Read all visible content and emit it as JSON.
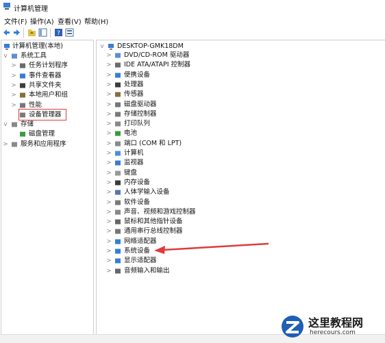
{
  "window": {
    "title": "计算机管理"
  },
  "menu": [
    "文件(F)",
    "操作(A)",
    "查看(V)",
    "帮助(H)"
  ],
  "left_tree": {
    "root": "计算机管理(本地)",
    "items": [
      {
        "label": "系统工具",
        "level": 1,
        "arrow": "v",
        "icon": "tools-icon"
      },
      {
        "label": "任务计划程序",
        "level": 2,
        "arrow": ">",
        "icon": "clock-icon"
      },
      {
        "label": "事件查看器",
        "level": 2,
        "arrow": ">",
        "icon": "event-viewer-icon"
      },
      {
        "label": "共享文件夹",
        "level": 2,
        "arrow": ">",
        "icon": "shared-folder-icon"
      },
      {
        "label": "本地用户和组",
        "level": 2,
        "arrow": ">",
        "icon": "users-icon"
      },
      {
        "label": "性能",
        "level": 2,
        "arrow": ">",
        "icon": "performance-icon"
      },
      {
        "label": "设备管理器",
        "level": 2,
        "arrow": "",
        "icon": "device-manager-icon",
        "selected": true
      },
      {
        "label": "存储",
        "level": 1,
        "arrow": "v",
        "icon": "storage-icon"
      },
      {
        "label": "磁盘管理",
        "level": 2,
        "arrow": "",
        "icon": "disk-icon"
      },
      {
        "label": "服务和应用程序",
        "level": 1,
        "arrow": ">",
        "icon": "services-icon"
      }
    ]
  },
  "device_tree": {
    "root": "DESKTOP-GMK18DM",
    "items": [
      {
        "label": "DVD/CD-ROM 驱动器",
        "icon": "dvd-icon"
      },
      {
        "label": "IDE ATA/ATAPI 控制器",
        "icon": "ide-icon"
      },
      {
        "label": "便携设备",
        "icon": "portable-icon"
      },
      {
        "label": "处理器",
        "icon": "cpu-icon"
      },
      {
        "label": "传感器",
        "icon": "sensor-icon"
      },
      {
        "label": "磁盘驱动器",
        "icon": "disk-drive-icon"
      },
      {
        "label": "存储控制器",
        "icon": "storage-controller-icon"
      },
      {
        "label": "打印队列",
        "icon": "printer-icon"
      },
      {
        "label": "电池",
        "icon": "battery-icon"
      },
      {
        "label": "端口 (COM 和 LPT)",
        "icon": "port-icon"
      },
      {
        "label": "计算机",
        "icon": "computer-icon"
      },
      {
        "label": "监视器",
        "icon": "monitor-icon"
      },
      {
        "label": "键盘",
        "icon": "keyboard-icon"
      },
      {
        "label": "内存设备",
        "icon": "memory-icon"
      },
      {
        "label": "人体学输入设备",
        "icon": "hid-icon"
      },
      {
        "label": "软件设备",
        "icon": "software-device-icon"
      },
      {
        "label": "声音、视频和游戏控制器",
        "icon": "sound-icon"
      },
      {
        "label": "鼠标和其他指针设备",
        "icon": "mouse-icon"
      },
      {
        "label": "通用串行总线控制器",
        "icon": "usb-icon"
      },
      {
        "label": "网络适配器",
        "icon": "network-icon"
      },
      {
        "label": "系统设备",
        "icon": "system-device-icon"
      },
      {
        "label": "显示适配器",
        "icon": "display-adapter-icon"
      },
      {
        "label": "音频输入和输出",
        "icon": "audio-io-icon"
      }
    ]
  },
  "annotation": {
    "arrow_color": "#e03a3a",
    "target": "系统设备"
  },
  "watermark": {
    "title": "这里教程网",
    "url": "herecours.com"
  },
  "colors": {
    "accent": "#2f7fd6",
    "highlight": "#e03a3a"
  }
}
